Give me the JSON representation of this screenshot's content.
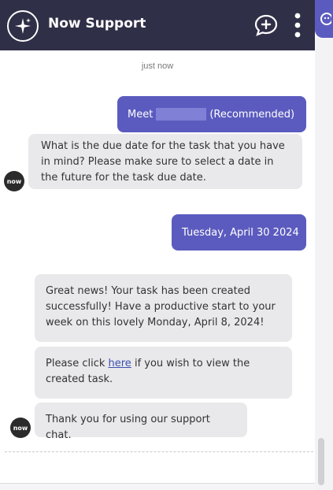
{
  "header": {
    "title": "Now Support",
    "logo_icon": "sparkle-icon",
    "new_chat_icon": "chat-plus-icon",
    "more_icon": "vertical-dots-icon",
    "colors": {
      "background": "#2f2f47",
      "accent": "#5b5bbf"
    }
  },
  "chat": {
    "timestamp": "just now",
    "avatar_label": "now",
    "messages": {
      "user_1_prefix": "Meet",
      "user_1_suffix": "(Recommended)",
      "bot_1": "What is the due date for the task that you have in mind? Please make sure to select a date in the future for the task due date.",
      "user_2": "Tuesday, April 30 2024",
      "bot_2": "Great news! Your task has been created successfully! Have a productive start to your week on this lovely Monday, April 8, 2024!",
      "bot_3_prefix": "Please click",
      "bot_3_link": "here",
      "bot_3_suffix": "if you wish to view the created task.",
      "bot_4": "Thank you for using our support chat."
    }
  }
}
